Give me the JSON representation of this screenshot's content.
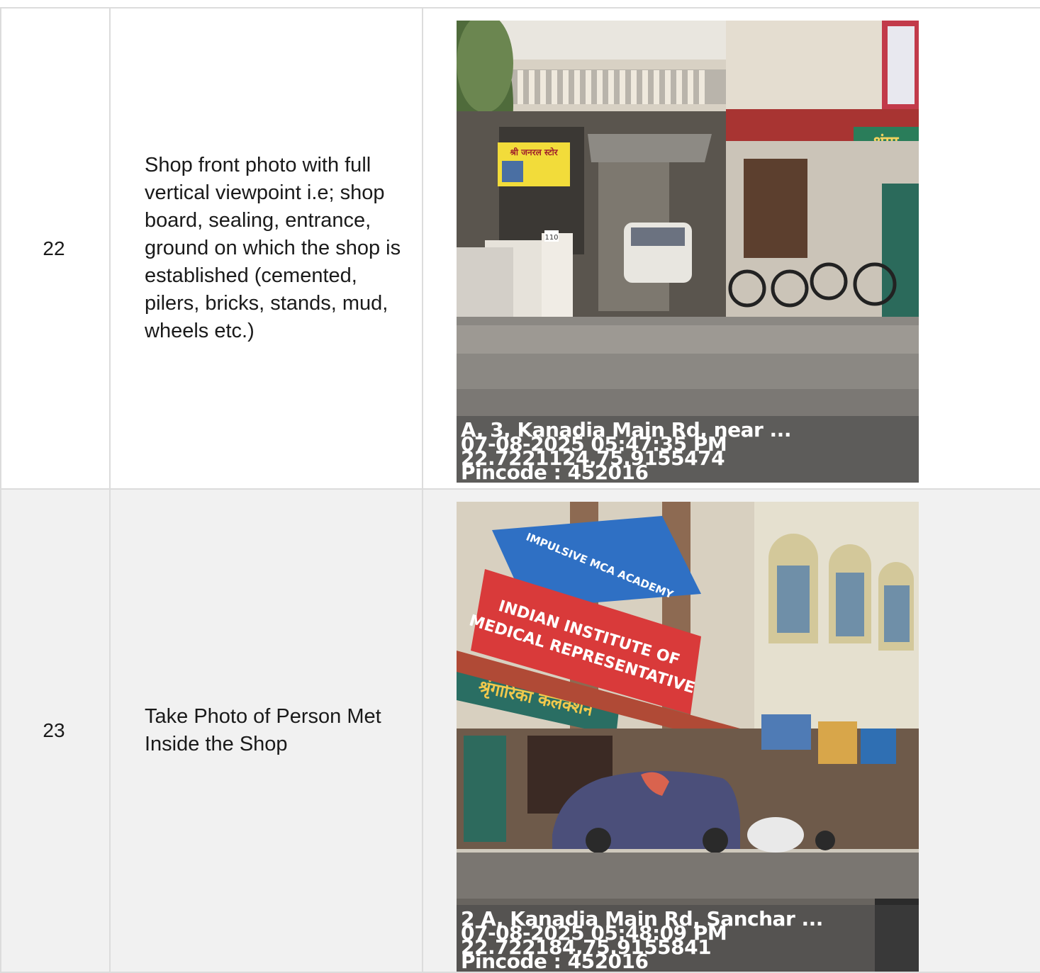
{
  "rows": [
    {
      "number": "22",
      "description": "Shop front photo with full vertical viewpoint i.e; shop board, sealing, entrance, ground on which the shop is established (cemented, pilers, bricks, stands, mud, wheels etc.)",
      "photo": {
        "address": "A, 3, Kanadia Main Rd, near ...",
        "datetime": "07-08-2025 05:47:35 PM",
        "coordinates": "22.7221124,75.9155474",
        "pincode": "Pincode : 452016",
        "sign_text": "श्री जनरल स्टोर",
        "sign2_text": "श्रृंगा",
        "house_number": "110"
      }
    },
    {
      "number": "23",
      "description": "Take Photo of Person Met Inside the Shop",
      "photo": {
        "address": "2 A, Kanadia Main Rd, Sanchar ...",
        "datetime": "07-08-2025 05:48:09 PM",
        "coordinates": "22.722184,75.9155841",
        "pincode": "Pincode : 452016",
        "banner_line1": "INDIAN INSTITUTE OF",
        "banner_line2": "MEDICAL REPRESENTATIVE",
        "academy": "IMPULSIVE MCA ACADEMY",
        "awning_text": "श्रृंगारिका कलेक्शन"
      }
    }
  ]
}
